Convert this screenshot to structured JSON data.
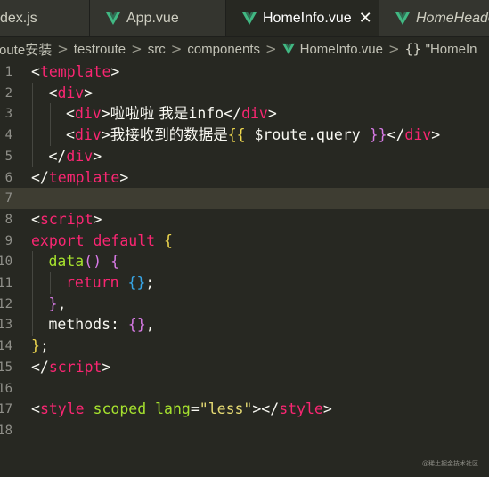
{
  "tabs": [
    {
      "label": "index.js",
      "visible_label": "dex.js",
      "icon": "js-icon",
      "active": false
    },
    {
      "label": "App.vue",
      "icon": "vue-icon",
      "active": false
    },
    {
      "label": "HomeInfo.vue",
      "icon": "vue-icon",
      "active": true,
      "close": "✕"
    },
    {
      "label": "HomeHeader",
      "visible_label": "HomeHeade",
      "icon": "vue-icon",
      "active": false,
      "italic": true
    }
  ],
  "breadcrumb": {
    "items": [
      "route安装",
      "testroute",
      "src",
      "components",
      "HomeInfo.vue",
      "\"HomeIn"
    ],
    "separator": ">",
    "symbol_braces": "{}"
  },
  "editor": {
    "current_line": 7,
    "lines": [
      {
        "gutter": "1",
        "tokens": [
          [
            "tk-punc",
            "<"
          ],
          [
            "tk-tag",
            "template"
          ],
          [
            "tk-punc",
            ">"
          ]
        ]
      },
      {
        "gutter": "2",
        "indent": 1,
        "tokens": [
          [
            "tk-punc",
            "<"
          ],
          [
            "tk-tag",
            "div"
          ],
          [
            "tk-punc",
            ">"
          ]
        ]
      },
      {
        "gutter": "3",
        "indent": 2,
        "tokens": [
          [
            "tk-punc",
            "<"
          ],
          [
            "tk-tag",
            "div"
          ],
          [
            "tk-punc",
            ">"
          ],
          [
            "tk-text",
            "啦啦啦 我是"
          ],
          [
            "tk-var",
            "info"
          ],
          [
            "tk-punc",
            "</"
          ],
          [
            "tk-tag",
            "div"
          ],
          [
            "tk-punc",
            ">"
          ]
        ]
      },
      {
        "gutter": "4",
        "indent": 2,
        "tokens": [
          [
            "tk-punc",
            "<"
          ],
          [
            "tk-tag",
            "div"
          ],
          [
            "tk-punc",
            ">"
          ],
          [
            "tk-text",
            "我接收到的数据是"
          ],
          [
            "tk-brace",
            "{{"
          ],
          [
            "tk-var",
            " $route.query "
          ],
          [
            "tk-brace2",
            "}}"
          ],
          [
            "tk-punc",
            "</"
          ],
          [
            "tk-tag",
            "div"
          ],
          [
            "tk-punc",
            ">"
          ]
        ]
      },
      {
        "gutter": "5",
        "indent": 1,
        "tokens": [
          [
            "tk-punc",
            "</"
          ],
          [
            "tk-tag",
            "div"
          ],
          [
            "tk-punc",
            ">"
          ]
        ]
      },
      {
        "gutter": "6",
        "tokens": [
          [
            "tk-punc",
            "</"
          ],
          [
            "tk-tag",
            "template"
          ],
          [
            "tk-punc",
            ">"
          ]
        ]
      },
      {
        "gutter": "7",
        "tokens": []
      },
      {
        "gutter": "8",
        "tokens": [
          [
            "tk-punc",
            "<"
          ],
          [
            "tk-tag",
            "script"
          ],
          [
            "tk-punc",
            ">"
          ]
        ]
      },
      {
        "gutter": "9",
        "tokens": [
          [
            "tk-kw",
            "export default "
          ],
          [
            "tk-brace",
            "{"
          ]
        ]
      },
      {
        "gutter": "10",
        "indent": 1,
        "tokens": [
          [
            "tk-fn",
            "data"
          ],
          [
            "tk-brace2",
            "()"
          ],
          [
            "tk-var",
            " "
          ],
          [
            "tk-brace2",
            "{"
          ]
        ]
      },
      {
        "gutter": "11",
        "indent": 2,
        "tokens": [
          [
            "tk-kw",
            "return "
          ],
          [
            "tk-brace3",
            "{}"
          ],
          [
            "tk-punc",
            ";"
          ]
        ]
      },
      {
        "gutter": "12",
        "indent": 1,
        "tokens": [
          [
            "tk-brace2",
            "}"
          ],
          [
            "tk-punc",
            ","
          ]
        ]
      },
      {
        "gutter": "13",
        "indent": 1,
        "tokens": [
          [
            "tk-var",
            "methods: "
          ],
          [
            "tk-brace2",
            "{}"
          ],
          [
            "tk-punc",
            ","
          ]
        ]
      },
      {
        "gutter": "14",
        "tokens": [
          [
            "tk-brace",
            "}"
          ],
          [
            "tk-punc",
            ";"
          ]
        ]
      },
      {
        "gutter": "15",
        "tokens": [
          [
            "tk-punc",
            "</"
          ],
          [
            "tk-tag",
            "script"
          ],
          [
            "tk-punc",
            ">"
          ]
        ]
      },
      {
        "gutter": "16",
        "tokens": []
      },
      {
        "gutter": "17",
        "tokens": [
          [
            "tk-punc",
            "<"
          ],
          [
            "tk-tag",
            "style "
          ],
          [
            "tk-attr",
            "scoped lang"
          ],
          [
            "tk-punc",
            "="
          ],
          [
            "tk-str",
            "\"less\""
          ],
          [
            "tk-punc",
            "></"
          ],
          [
            "tk-tag",
            "style"
          ],
          [
            "tk-punc",
            ">"
          ]
        ]
      },
      {
        "gutter": "18",
        "tokens": []
      }
    ]
  },
  "watermark": "@稀土掘金技术社区",
  "colors": {
    "background": "#272822",
    "tab_inactive": "#34352f",
    "vue_green": "#41b883",
    "line_highlight": "#3e3d32"
  }
}
